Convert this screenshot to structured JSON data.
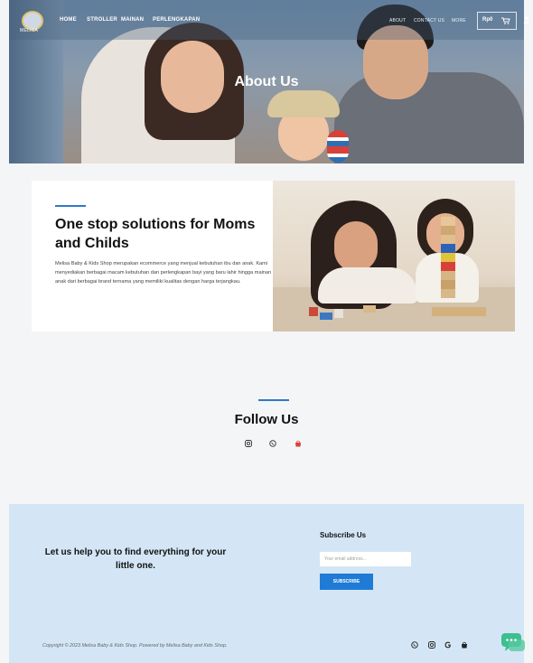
{
  "nav": {
    "logo_text": "MELISA",
    "items": [
      "HOME",
      "STROLLER",
      "MAINAN",
      "PERLENGKAPAN"
    ],
    "right_items": [
      "ABOUT",
      "CONTACT US",
      "MORE"
    ],
    "cart_amount": "Rp0",
    "icons": [
      "cart-icon",
      "user-icon"
    ]
  },
  "hero": {
    "title": "About Us"
  },
  "about": {
    "heading": "One stop solutions for Moms and Childs",
    "body": "Melisa Baby & Kids Shop merupakan ecommerce yang menjual kebutuhan ibu dan anak. Kami menyediakan berbagai macam kebutuhan dan perlengkapan bayi yang baru lahir hingga mainan anak dari berbagai brand ternama yang memiliki kualitas dengan harga terjangkau."
  },
  "follow": {
    "title": "Follow Us",
    "icons": [
      "instagram-icon",
      "whatsapp-icon",
      "shop-icon"
    ]
  },
  "footer": {
    "tagline": "Let us help you to find everything for your little one.",
    "subscribe_title": "Subscribe Us",
    "email_placeholder": "Your email address...",
    "subscribe_button": "SUBSCRIBE",
    "copyright": "Copyright © 2023 Melisa Baby & Kids Shop. Powered by Melisa Baby and Kids Shop.",
    "social_icons": [
      "whatsapp-icon",
      "instagram-icon",
      "google-icon",
      "shop-icon"
    ],
    "chat_icon": "chat-icon"
  },
  "colors": {
    "accent": "#2f79c9",
    "button": "#1f7bd6",
    "footer_bg": "#d4e6f6",
    "page_bg": "#f4f5f7",
    "chat": "#3dbf8f"
  }
}
